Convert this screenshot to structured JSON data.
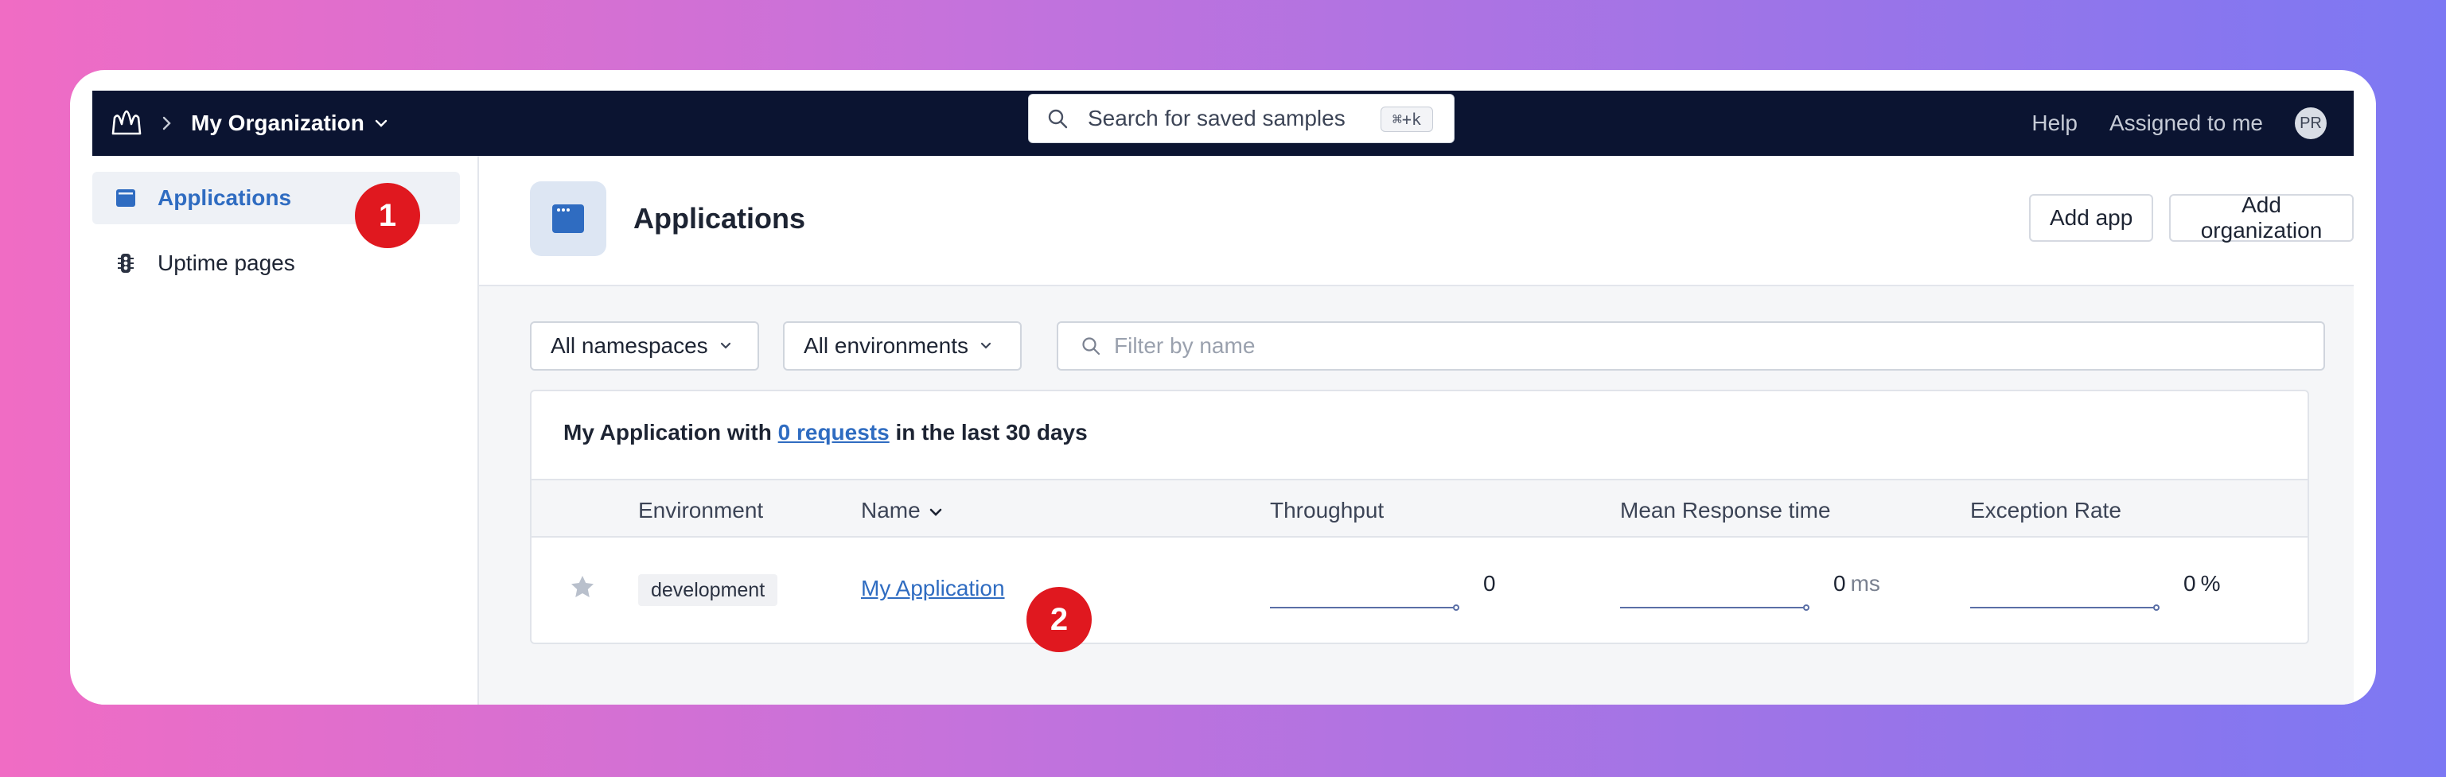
{
  "topbar": {
    "org_name": "My Organization",
    "search_placeholder": "Search for saved samples",
    "search_shortcut": "⌘+k",
    "help": "Help",
    "assigned": "Assigned to me",
    "avatar_initials": "PR"
  },
  "sidebar": {
    "items": [
      {
        "label": "Applications",
        "icon": "browser-window-icon",
        "active": true
      },
      {
        "label": "Uptime pages",
        "icon": "traffic-light-icon",
        "active": false
      }
    ]
  },
  "annotations": {
    "one": "1",
    "two": "2"
  },
  "header": {
    "title": "Applications",
    "add_app": "Add app",
    "add_org": "Add organization"
  },
  "filters": {
    "namespaces": "All namespaces",
    "environments": "All environments",
    "name_placeholder": "Filter by name"
  },
  "card": {
    "title_prefix": "My Application with ",
    "title_link": "0 requests",
    "title_suffix": " in the last 30 days",
    "columns": {
      "environment": "Environment",
      "name": "Name",
      "throughput": "Throughput",
      "response": "Mean Response time",
      "exception": "Exception Rate"
    },
    "row": {
      "environment": "development",
      "name": "My Application",
      "throughput": "0",
      "response": "0",
      "response_unit": "ms",
      "exception": "0",
      "exception_unit": "%"
    }
  },
  "colors": {
    "accent": "#2f6cc1",
    "topbar": "#0b1431",
    "badge": "#e0181f"
  }
}
